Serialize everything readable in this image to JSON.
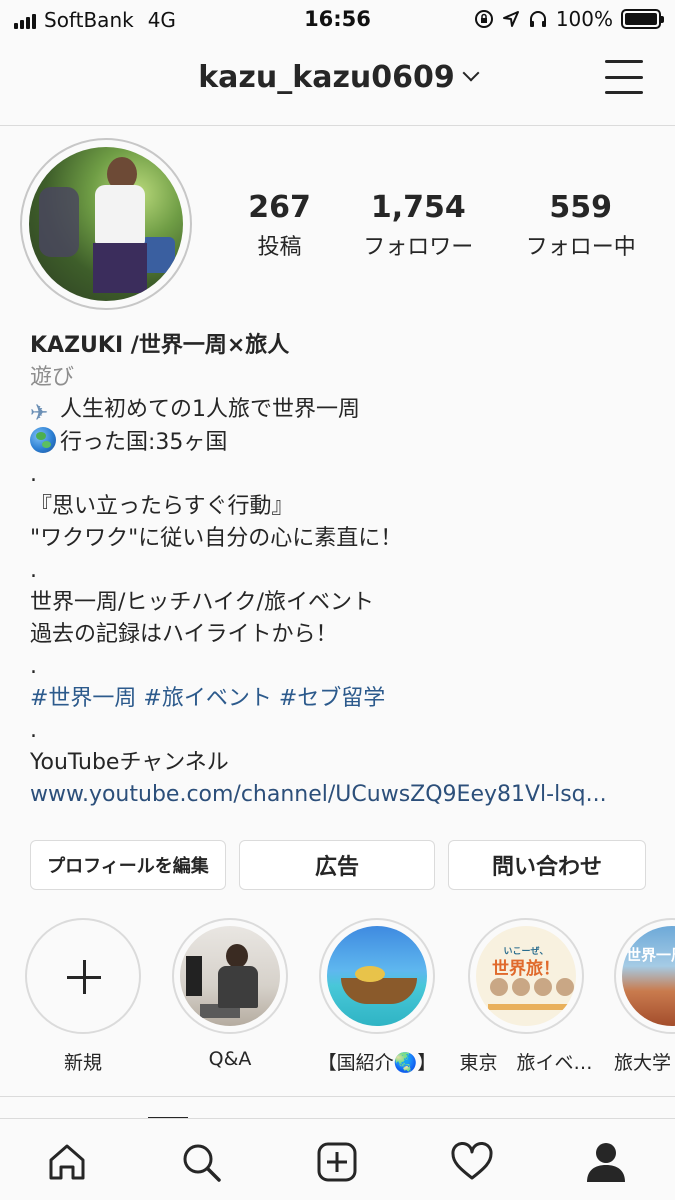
{
  "status_bar": {
    "carrier": "SoftBank",
    "network": "4G",
    "time": "16:56",
    "battery": "100%",
    "battery_level": 1.0,
    "icons": [
      "signal-icon",
      "lock-rotation-icon",
      "location-icon",
      "headphones-icon",
      "battery-icon"
    ]
  },
  "header": {
    "username": "kazu_kazu0609",
    "icons": [
      "chevron-down-icon",
      "menu-icon"
    ]
  },
  "stats": [
    {
      "value": "267",
      "label": "投稿"
    },
    {
      "value": "1,754",
      "label": "フォロワー"
    },
    {
      "value": "559",
      "label": "フォロー中"
    }
  ],
  "bio": {
    "name": "KAZUKI /世界一周×旅人",
    "category": "遊び",
    "line1": "人生初めての1人旅で世界一周",
    "line2": "行った国:35ヶ国",
    "dot1": ".",
    "quote1": "『思い立ったらすぐ行動』",
    "quote2": "\"ワクワク\"に従い自分の心に素直に！",
    "dot2": ".",
    "line3": "世界一周/ヒッチハイク/旅イベント",
    "line4": "過去の記録はハイライトから！",
    "dot3": ".",
    "hashtags": "#世界一周 #旅イベント #セブ留学",
    "dot4": ".",
    "youtube_label": "YouTubeチャンネル",
    "link": "www.youtube.com/channel/UCuwsZQ9Eey81Vl-lsq..."
  },
  "buttons": {
    "edit_profile": "プロフィールを編集",
    "ads": "広告",
    "contact": "問い合わせ"
  },
  "highlights": [
    {
      "label": "新規"
    },
    {
      "label": "Q&A"
    },
    {
      "label": "【国紹介🌏】"
    },
    {
      "label": "東京　旅イベ…",
      "image_text_small": "いこーぜ、",
      "image_text_big": "世界旅！"
    },
    {
      "label": "旅大学",
      "image_text": "世界一周"
    }
  ],
  "bottom_nav": [
    "home-icon",
    "search-icon",
    "new-post-icon",
    "activity-heart-icon",
    "profile-icon"
  ]
}
